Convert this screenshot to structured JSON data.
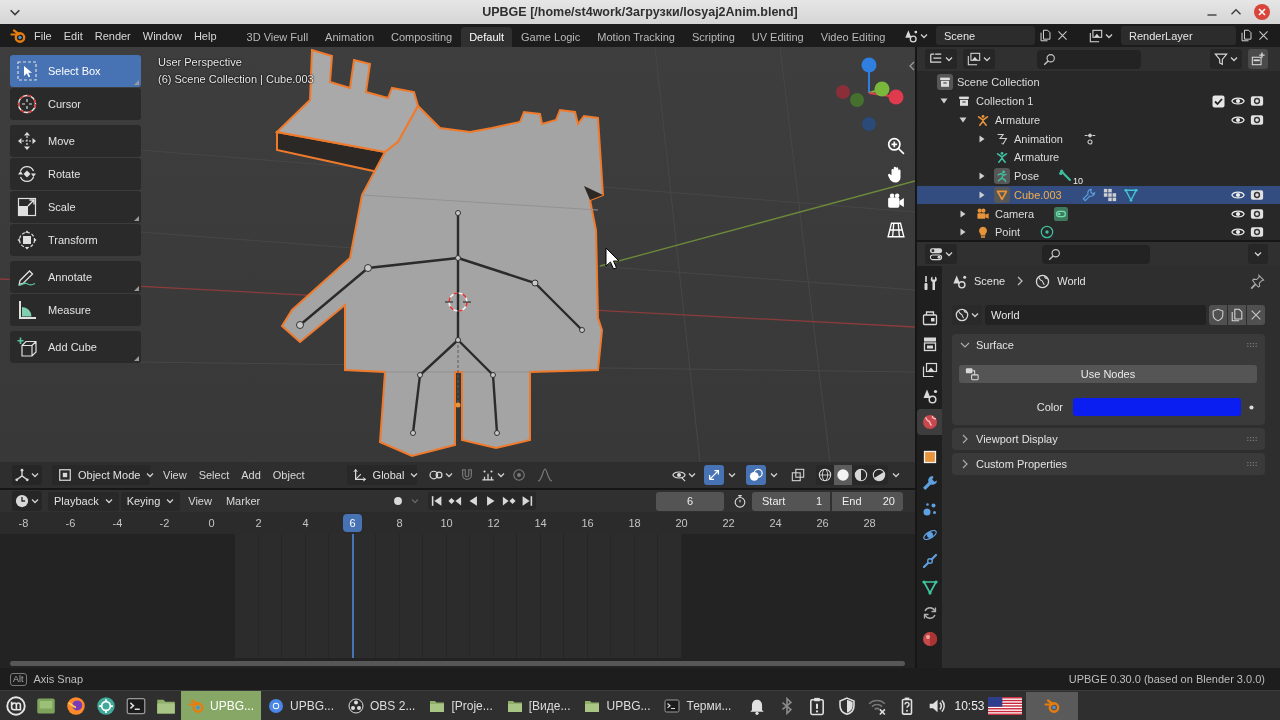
{
  "window": {
    "title": "UPBGE [/home/st4work/Загрузки/losyaj2Anim.blend]"
  },
  "topbar": {
    "menus": [
      "File",
      "Edit",
      "Render",
      "Window",
      "Help"
    ],
    "workspaces": [
      {
        "label": "3D View Full",
        "selected": false
      },
      {
        "label": "Animation",
        "selected": false
      },
      {
        "label": "Compositing",
        "selected": false
      },
      {
        "label": "Default",
        "selected": true
      },
      {
        "label": "Game Logic",
        "selected": false
      },
      {
        "label": "Motion Tracking",
        "selected": false
      },
      {
        "label": "Scripting",
        "selected": false
      },
      {
        "label": "UV Editing",
        "selected": false
      },
      {
        "label": "Video Editing",
        "selected": false
      }
    ],
    "scene": "Scene",
    "view_layer": "RenderLayer"
  },
  "viewport": {
    "view_name": "User Perspective",
    "context": "(6) Scene Collection | Cube.003",
    "toolbar": [
      [
        {
          "kind": "select_box",
          "label": "Select Box",
          "selected": true,
          "more": true
        },
        {
          "kind": "cursor",
          "label": "Cursor",
          "selected": false,
          "more": false
        }
      ],
      [
        {
          "kind": "move",
          "label": "Move",
          "selected": false,
          "more": false
        },
        {
          "kind": "rotate",
          "label": "Rotate",
          "selected": false,
          "more": false
        },
        {
          "kind": "scale",
          "label": "Scale",
          "selected": false,
          "more": true
        },
        {
          "kind": "transform",
          "label": "Transform",
          "selected": false,
          "more": false
        }
      ],
      [
        {
          "kind": "annotate",
          "label": "Annotate",
          "selected": false,
          "more": true
        },
        {
          "kind": "measure",
          "label": "Measure",
          "selected": false,
          "more": false
        }
      ],
      [
        {
          "kind": "add_cube",
          "label": "Add Cube",
          "selected": false,
          "more": true
        }
      ]
    ],
    "header": {
      "mode": "Object Mode",
      "menus": [
        "View",
        "Select",
        "Add",
        "Object"
      ],
      "orientation": "Global",
      "snap": false,
      "proportional": false,
      "gizmos": true,
      "overlays": true,
      "xray": false,
      "shading": [
        {
          "kind": "wireframe",
          "selected": false
        },
        {
          "kind": "solid",
          "selected": true
        },
        {
          "kind": "material",
          "selected": false
        },
        {
          "kind": "rendered",
          "selected": false
        }
      ]
    }
  },
  "timeline": {
    "menus": [
      {
        "label": "Playback",
        "dropdown": true
      },
      {
        "label": "Keying",
        "dropdown": true
      },
      {
        "label": "View",
        "dropdown": false
      },
      {
        "label": "Marker",
        "dropdown": false
      }
    ],
    "auto_keying": false,
    "current_frame": "6",
    "preview_range": false,
    "start": {
      "label": "Start",
      "value": "1"
    },
    "end": {
      "label": "End",
      "value": "20"
    },
    "ruler": [
      {
        "label": "-8",
        "selected": false
      },
      {
        "label": "-6",
        "selected": false
      },
      {
        "label": "-4",
        "selected": false
      },
      {
        "label": "-2",
        "selected": false
      },
      {
        "label": "0",
        "selected": false
      },
      {
        "label": "2",
        "selected": false
      },
      {
        "label": "4",
        "selected": false
      },
      {
        "label": "6",
        "selected": true
      },
      {
        "label": "8",
        "selected": false
      },
      {
        "label": "10",
        "selected": false
      },
      {
        "label": "12",
        "selected": false
      },
      {
        "label": "14",
        "selected": false
      },
      {
        "label": "16",
        "selected": false
      },
      {
        "label": "18",
        "selected": false
      },
      {
        "label": "20",
        "selected": false
      },
      {
        "label": "22",
        "selected": false
      },
      {
        "label": "24",
        "selected": false
      },
      {
        "label": "26",
        "selected": false
      },
      {
        "label": "28",
        "selected": false
      }
    ]
  },
  "outliner": {
    "tree": [
      {
        "kind": "collection",
        "label": "Scene Collection",
        "selected": false,
        "children": [
          {
            "kind": "collection",
            "label": "Collection 1",
            "selected": false,
            "expanded": true,
            "checked": true,
            "visible": true,
            "renderable": true,
            "children": [
              {
                "kind": "armature",
                "label": "Armature",
                "selected": false,
                "expanded": true,
                "visible": true,
                "renderable": true,
                "children": [
                  {
                    "kind": "action",
                    "label": "Animation",
                    "selected": false,
                    "expanded": false
                  },
                  {
                    "kind": "armature_data",
                    "label": "Armature",
                    "selected": false
                  },
                  {
                    "kind": "pose",
                    "label": "Pose",
                    "selected": false,
                    "expanded": false,
                    "count": "10"
                  },
                  {
                    "kind": "mesh",
                    "label": "Cube.003",
                    "selected": true,
                    "expanded": false,
                    "visible": true,
                    "renderable": true
                  }
                ]
              },
              {
                "kind": "camera",
                "label": "Camera",
                "selected": false,
                "expanded": false,
                "visible": true,
                "renderable": true
              },
              {
                "kind": "light",
                "label": "Point",
                "selected": false,
                "expanded": false,
                "visible": true,
                "renderable": true
              }
            ]
          }
        ]
      }
    ]
  },
  "properties": {
    "tabs": [
      [
        {
          "kind": "tool",
          "selected": false
        }
      ],
      [
        {
          "kind": "render",
          "selected": false
        },
        {
          "kind": "output",
          "selected": false
        },
        {
          "kind": "view_layer",
          "selected": false
        },
        {
          "kind": "scene",
          "selected": false
        },
        {
          "kind": "world",
          "selected": true
        }
      ],
      [
        {
          "kind": "object",
          "selected": false
        },
        {
          "kind": "modifiers",
          "selected": false
        },
        {
          "kind": "particles",
          "selected": false
        },
        {
          "kind": "physics",
          "selected": false
        },
        {
          "kind": "constraints",
          "selected": false
        },
        {
          "kind": "data",
          "selected": false
        },
        {
          "kind": "logic",
          "selected": false
        },
        {
          "kind": "material",
          "selected": false
        }
      ]
    ],
    "breadcrumb": [
      {
        "kind": "scene",
        "label": "Scene"
      },
      {
        "kind": "world",
        "label": "World"
      }
    ],
    "datablock": "World",
    "panels": [
      {
        "title": "Surface",
        "expanded": true,
        "button": "Use Nodes",
        "color_label": "Color",
        "color": "#0a1ef2"
      },
      {
        "title": "Viewport Display",
        "expanded": false
      },
      {
        "title": "Custom Properties",
        "expanded": false
      }
    ]
  },
  "status_bar": {
    "key": "Alt",
    "hint": "Axis Snap",
    "version": "UPBGE 0.30.0 (based on Blender 3.0.0)"
  },
  "taskbar": {
    "windows": [
      {
        "kind": "blender",
        "label": "UPBG...",
        "selected": true
      },
      {
        "kind": "chrome",
        "label": "UPBG...",
        "selected": false
      },
      {
        "kind": "obs",
        "label": "OBS 2...",
        "selected": false
      },
      {
        "kind": "folder",
        "label": "[Proje...",
        "selected": false
      },
      {
        "kind": "folder",
        "label": "[Виде...",
        "selected": false
      },
      {
        "kind": "folder",
        "label": "UPBG...",
        "selected": false
      },
      {
        "kind": "terminal",
        "label": "Терми...",
        "selected": false
      }
    ],
    "clock": "10:53"
  }
}
